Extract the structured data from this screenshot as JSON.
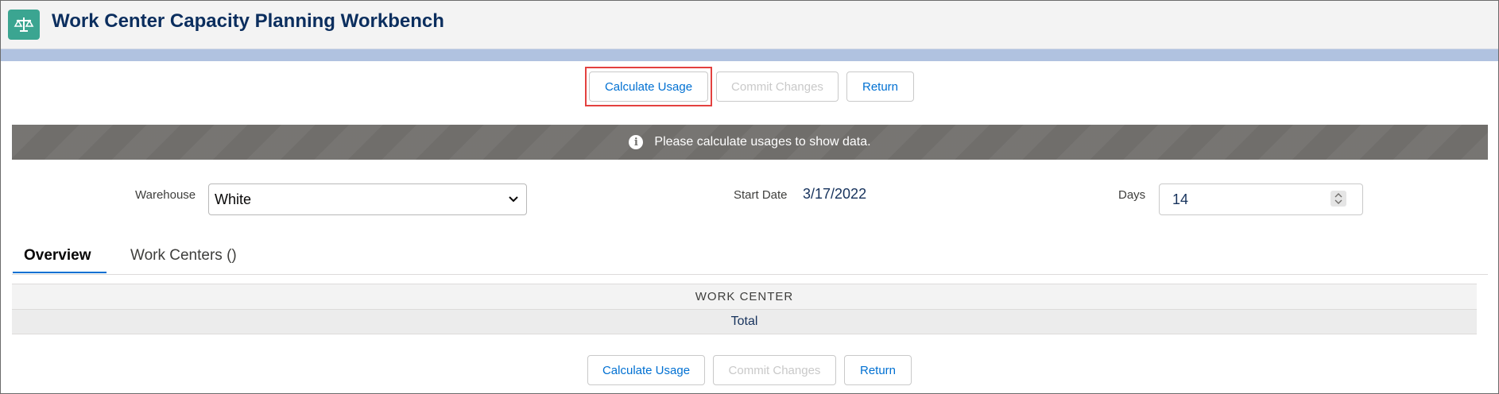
{
  "header": {
    "title": "Work Center Capacity Planning Workbench",
    "app_icon": "scales-icon"
  },
  "toolbar_top": {
    "calculate_label": "Calculate Usage",
    "commit_label": "Commit Changes",
    "return_label": "Return"
  },
  "banner": {
    "message": "Please calculate usages to show data.",
    "icon": "info-icon"
  },
  "filters": {
    "warehouse_label": "Warehouse",
    "warehouse_value": "White",
    "start_date_label": "Start Date",
    "start_date_value": "3/17/2022",
    "days_label": "Days",
    "days_value": "14"
  },
  "tabs": [
    {
      "label": "Overview",
      "active": true
    },
    {
      "label": "Work Centers ()",
      "active": false
    }
  ],
  "table": {
    "header": "WORK CENTER",
    "rows": [
      "Total"
    ]
  },
  "toolbar_bottom": {
    "calculate_label": "Calculate Usage",
    "commit_label": "Commit Changes",
    "return_label": "Return"
  },
  "colors": {
    "accent": "#0070d2",
    "title": "#0b2e5e",
    "app_icon_bg": "#3ba591",
    "banner_bg": "#706e6b",
    "highlight": "#e3413f"
  }
}
